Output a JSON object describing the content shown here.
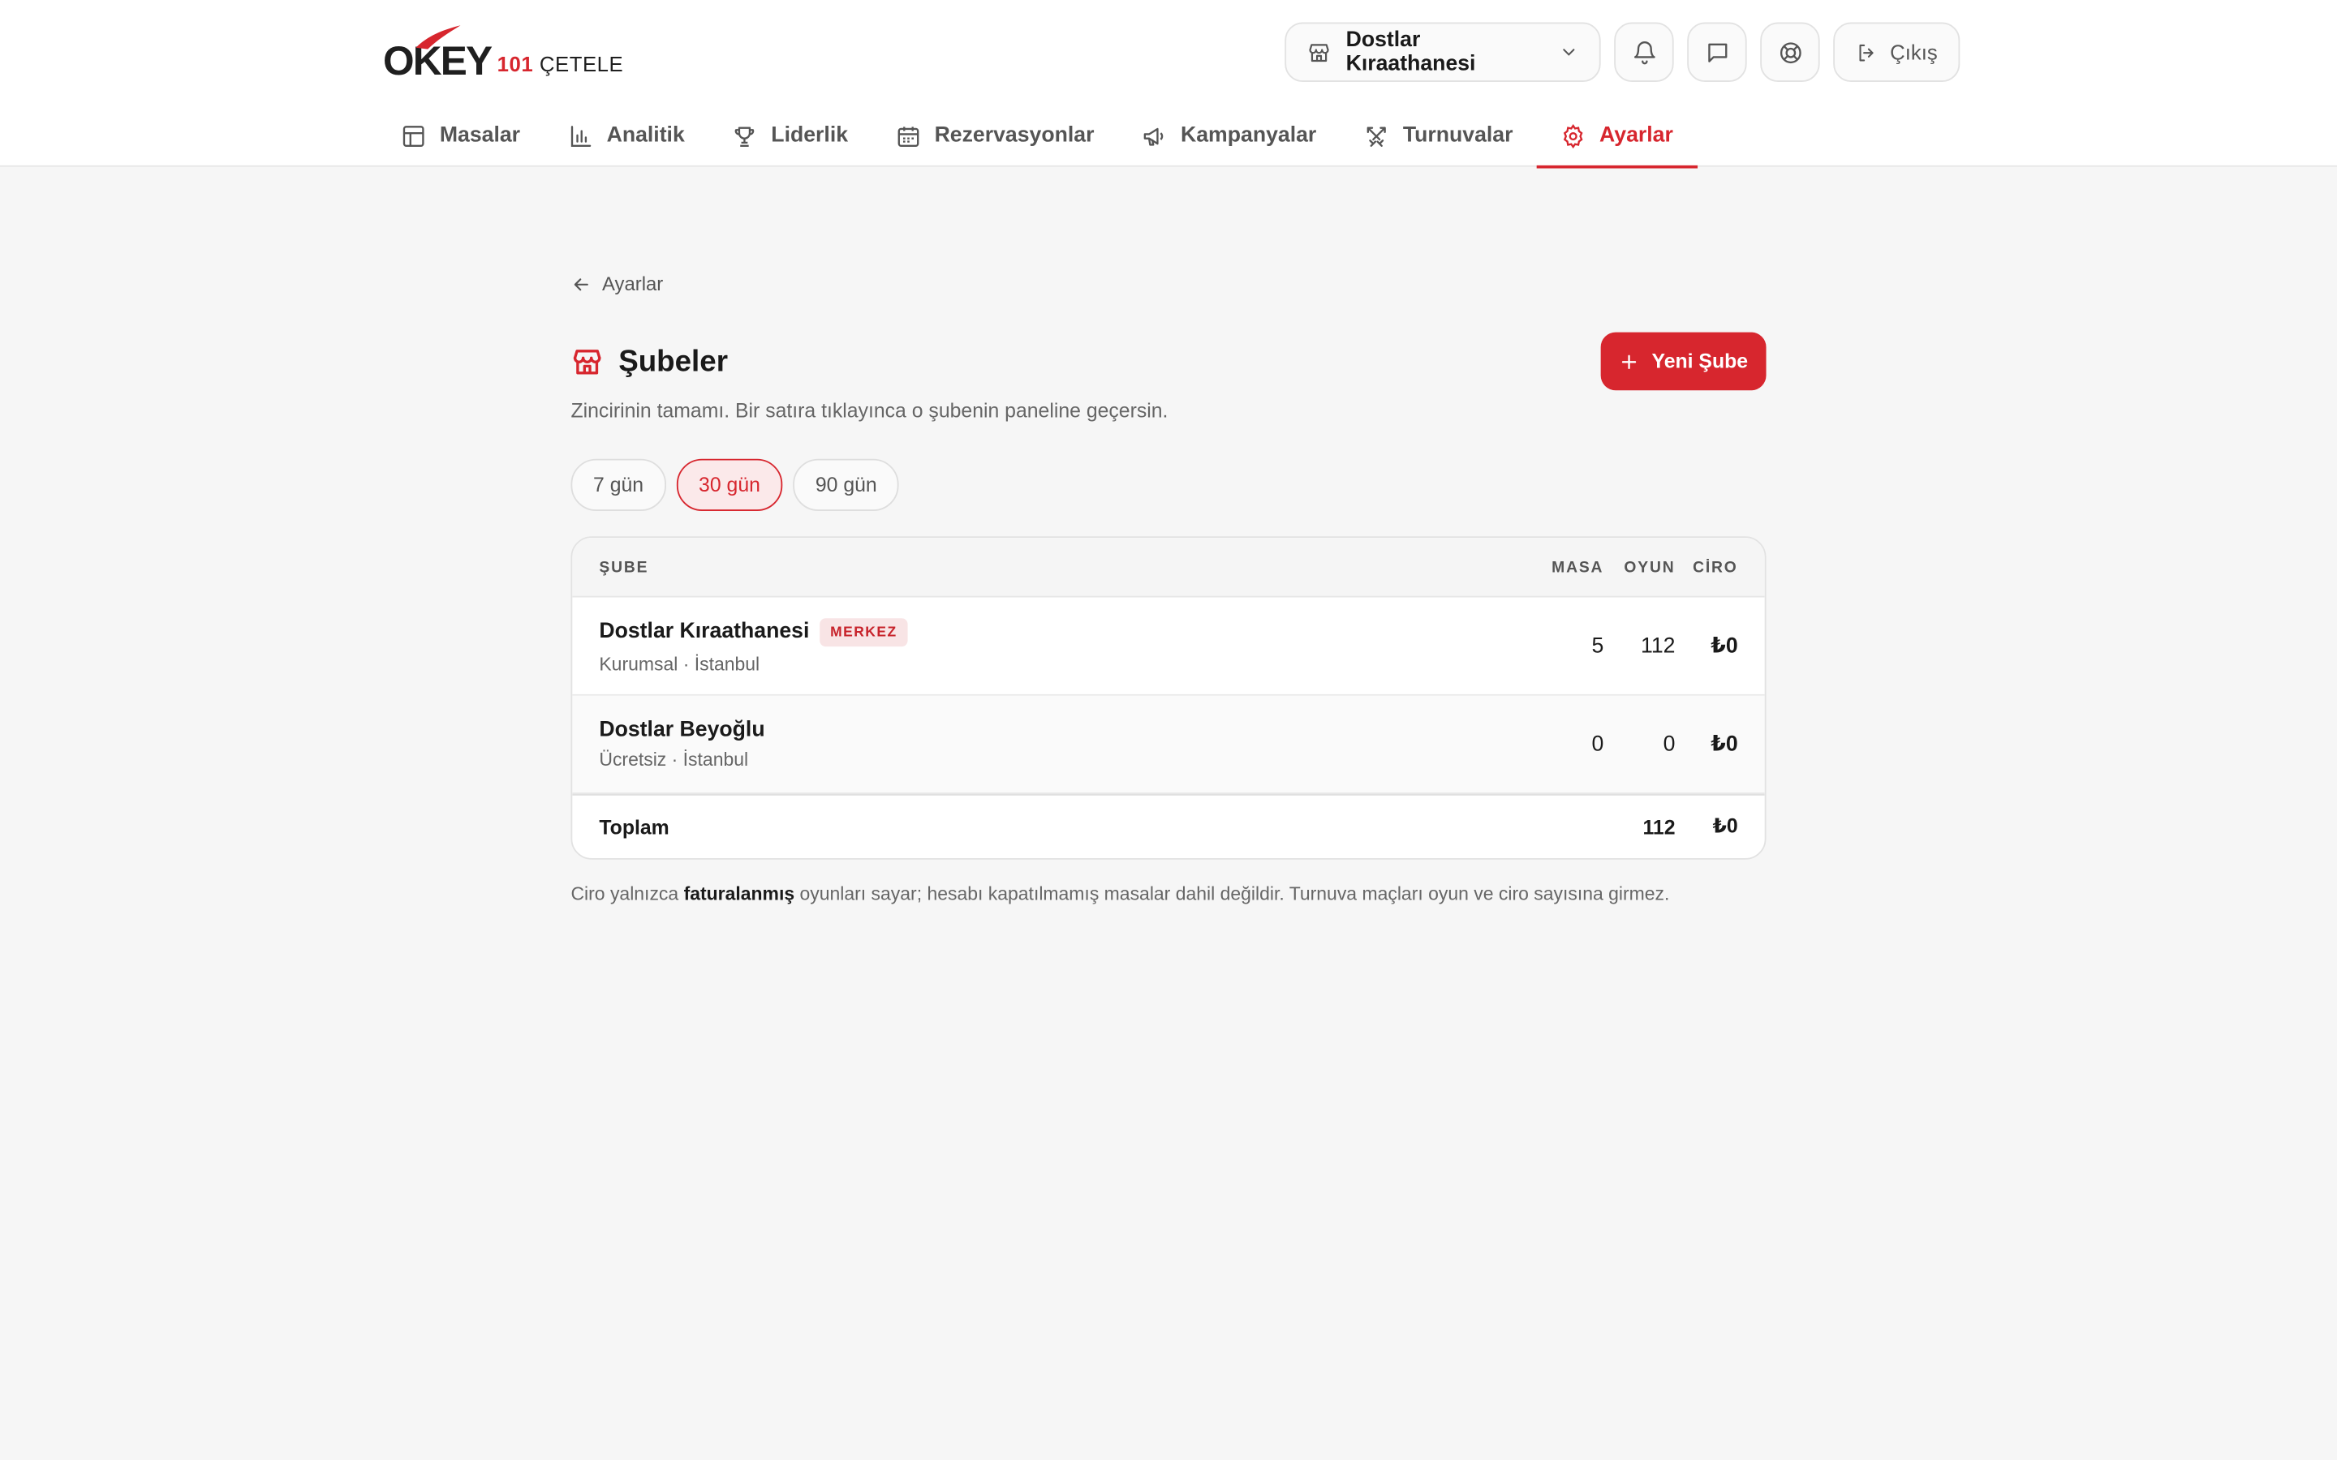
{
  "brand": {
    "logo_main": "OKEY",
    "logo_sub_red": "101",
    "logo_sub": "ÇETELE"
  },
  "header": {
    "branch_selector": "Dostlar Kıraathanesi",
    "logout_label": "Çıkış"
  },
  "nav": {
    "tabs": [
      {
        "label": "Masalar",
        "icon": "table-icon"
      },
      {
        "label": "Analitik",
        "icon": "bar-chart-icon"
      },
      {
        "label": "Liderlik",
        "icon": "trophy-icon"
      },
      {
        "label": "Rezervasyonlar",
        "icon": "calendar-icon"
      },
      {
        "label": "Kampanyalar",
        "icon": "megaphone-icon"
      },
      {
        "label": "Turnuvalar",
        "icon": "swords-icon"
      },
      {
        "label": "Ayarlar",
        "icon": "gear-icon",
        "active": true
      }
    ]
  },
  "page": {
    "back_label": "Ayarlar",
    "title": "Şubeler",
    "new_button": "Yeni Şube",
    "description": "Zincirinin tamamı. Bir satıra tıklayınca o şubenin paneline geçersin.",
    "ranges": [
      "7 gün",
      "30 gün",
      "90 gün"
    ],
    "active_range": "30 gün"
  },
  "table": {
    "columns": {
      "branch": "ŞUBE",
      "tables": "MASA",
      "games": "OYUN",
      "revenue": "CİRO"
    },
    "rows": [
      {
        "name": "Dostlar Kıraathanesi",
        "badge": "MERKEZ",
        "meta": "Kurumsal · İstanbul",
        "tables": "5",
        "games": "112",
        "revenue": "₺0"
      },
      {
        "name": "Dostlar Beyoğlu",
        "badge": "",
        "meta": "Ücretsiz · İstanbul",
        "tables": "0",
        "games": "0",
        "revenue": "₺0"
      }
    ],
    "total": {
      "label": "Toplam",
      "games": "112",
      "revenue": "₺0"
    }
  },
  "note": {
    "pre": "Ciro yalnızca ",
    "bold": "faturalanmış",
    "post": " oyunları sayar; hesabı kapatılmamış masalar dahil değildir. Turnuva maçları oyun ve ciro sayısına girmez."
  },
  "colors": {
    "accent": "#d7262e",
    "accent_soft": "#fbe9ea",
    "background": "#f6f6f6"
  }
}
